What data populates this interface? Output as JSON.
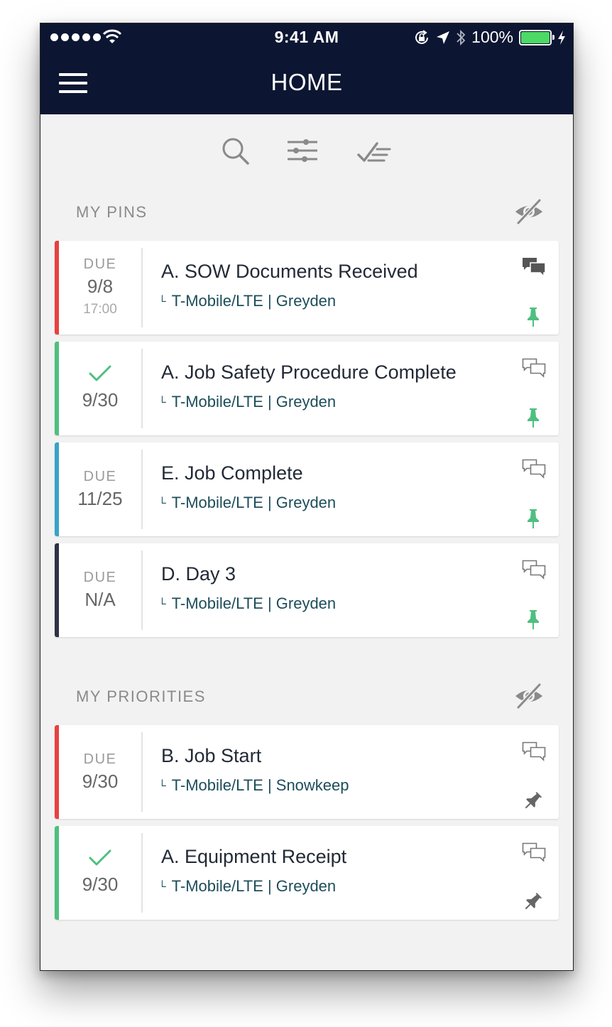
{
  "status_bar": {
    "time": "9:41 AM",
    "battery_percent": "100%",
    "icons": [
      "signal-dots-icon",
      "wifi-icon",
      "rotation-lock-icon",
      "location-arrow-icon",
      "bluetooth-icon",
      "battery-icon",
      "charging-bolt-icon"
    ]
  },
  "header": {
    "title": "HOME",
    "menu_icon": "hamburger-menu-icon",
    "background_color": "#0c1632"
  },
  "toolbar": {
    "icons": [
      "search-icon",
      "filter-sliders-icon",
      "checklist-icon"
    ]
  },
  "sections": {
    "pins": {
      "title": "MY PINS",
      "hide_icon": "eye-slash-icon"
    },
    "priorities": {
      "title": "MY PRIORITIES",
      "hide_icon": "eye-slash-icon"
    }
  },
  "colors": {
    "red": "#e84040",
    "green": "#4fbf80",
    "blue": "#3aa3c8",
    "dark": "#2e3346",
    "pin_green": "#4fbf80",
    "pin_gray": "#666666"
  },
  "pins": [
    {
      "due_label": "DUE",
      "date": "9/8",
      "time": "17:00",
      "title": "A. SOW Documents Received",
      "subtitle": "T-Mobile/LTE | Greyden",
      "stripe": "red",
      "completed": false,
      "chat_filled": true,
      "pinned": true
    },
    {
      "due_label": "",
      "date": "9/30",
      "time": "",
      "title": "A. Job Safety Procedure Complete",
      "subtitle": "T-Mobile/LTE | Greyden",
      "stripe": "green",
      "completed": true,
      "chat_filled": false,
      "pinned": true
    },
    {
      "due_label": "DUE",
      "date": "11/25",
      "time": "",
      "title": "E. Job Complete",
      "subtitle": "T-Mobile/LTE | Greyden",
      "stripe": "blue",
      "completed": false,
      "chat_filled": false,
      "pinned": true
    },
    {
      "due_label": "DUE",
      "date": "N/A",
      "time": "",
      "title": "D. Day 3",
      "subtitle": "T-Mobile/LTE | Greyden",
      "stripe": "dark",
      "completed": false,
      "chat_filled": false,
      "pinned": true
    }
  ],
  "priorities": [
    {
      "due_label": "DUE",
      "date": "9/30",
      "time": "",
      "title": "B. Job Start",
      "subtitle": "T-Mobile/LTE | Snowkeep",
      "stripe": "red",
      "completed": false,
      "chat_filled": false,
      "pinned": false
    },
    {
      "due_label": "",
      "date": "9/30",
      "time": "",
      "title": "A. Equipment Receipt",
      "subtitle": "T-Mobile/LTE | Greyden",
      "stripe": "green",
      "completed": true,
      "chat_filled": false,
      "pinned": false
    }
  ]
}
